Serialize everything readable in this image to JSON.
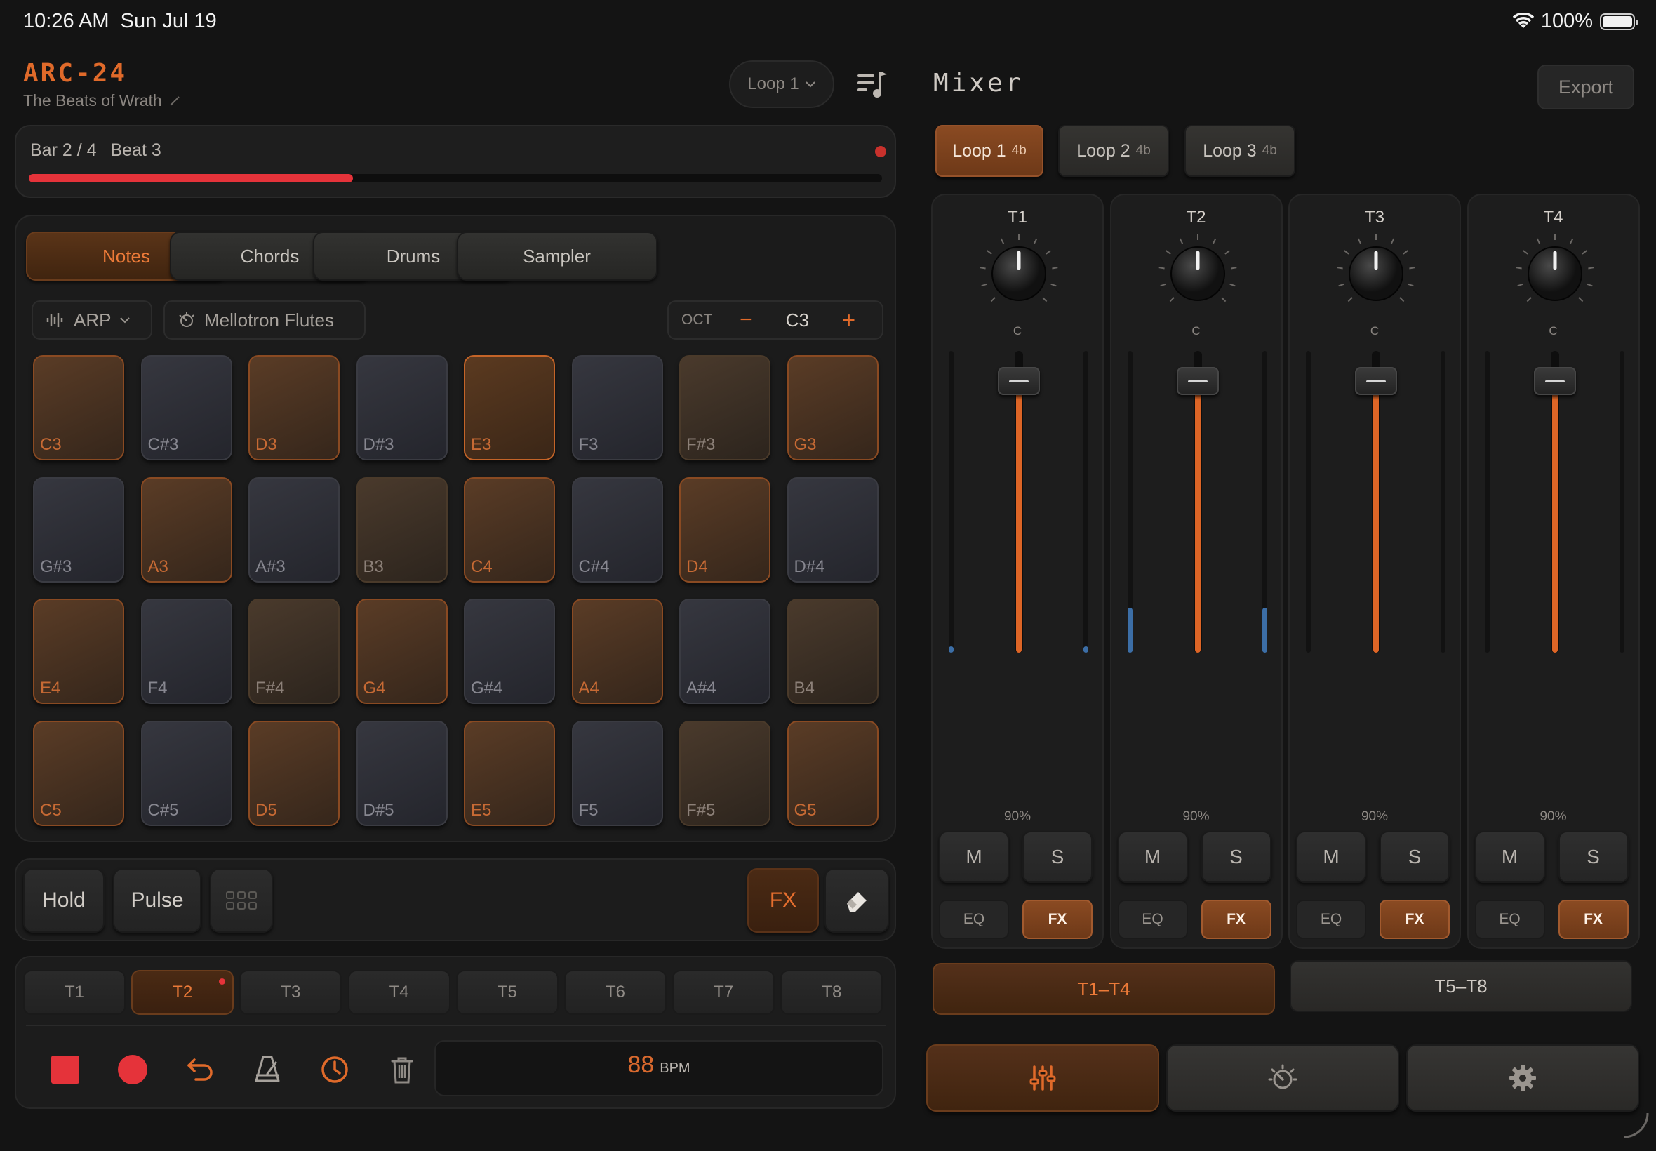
{
  "status": {
    "time": "10:26 AM",
    "date": "Sun Jul 19",
    "battery": "100%"
  },
  "header": {
    "app_title": "ARC-24",
    "song_title": "The Beats of Wrath",
    "loop_select": "Loop 1"
  },
  "progress": {
    "bar": "Bar 2 / 4",
    "beat": "Beat 3",
    "fraction": 0.38
  },
  "tabs": [
    {
      "label": "Notes",
      "active": true
    },
    {
      "label": "Chords",
      "active": false
    },
    {
      "label": "Drums",
      "active": false
    },
    {
      "label": "Sampler",
      "active": false
    }
  ],
  "options": {
    "mode": "ARP",
    "instrument": "Mellotron Flutes",
    "oct_label": "OCT",
    "oct_minus": "−",
    "oct_value": "C3",
    "oct_plus": "+"
  },
  "pads": [
    {
      "note": "C3",
      "type": "hl"
    },
    {
      "note": "C#3",
      "type": "sharp"
    },
    {
      "note": "D3",
      "type": "hl"
    },
    {
      "note": "D#3",
      "type": "sharp"
    },
    {
      "note": "E3",
      "type": "hot"
    },
    {
      "note": "F3",
      "type": "sharp"
    },
    {
      "note": "F#3",
      "type": "nat"
    },
    {
      "note": "G3",
      "type": "hl"
    },
    {
      "note": "G#3",
      "type": "sharp"
    },
    {
      "note": "A3",
      "type": "hl"
    },
    {
      "note": "A#3",
      "type": "sharp"
    },
    {
      "note": "B3",
      "type": "nat"
    },
    {
      "note": "C4",
      "type": "hl"
    },
    {
      "note": "C#4",
      "type": "sharp"
    },
    {
      "note": "D4",
      "type": "hl"
    },
    {
      "note": "D#4",
      "type": "sharp"
    },
    {
      "note": "E4",
      "type": "hl"
    },
    {
      "note": "F4",
      "type": "sharp"
    },
    {
      "note": "F#4",
      "type": "nat"
    },
    {
      "note": "G4",
      "type": "hl"
    },
    {
      "note": "G#4",
      "type": "sharp"
    },
    {
      "note": "A4",
      "type": "hl"
    },
    {
      "note": "A#4",
      "type": "sharp"
    },
    {
      "note": "B4",
      "type": "nat"
    },
    {
      "note": "C5",
      "type": "hl"
    },
    {
      "note": "C#5",
      "type": "sharp"
    },
    {
      "note": "D5",
      "type": "hl"
    },
    {
      "note": "D#5",
      "type": "sharp"
    },
    {
      "note": "E5",
      "type": "hl"
    },
    {
      "note": "F5",
      "type": "sharp"
    },
    {
      "note": "F#5",
      "type": "nat"
    },
    {
      "note": "G5",
      "type": "hl"
    }
  ],
  "hold_bar": {
    "hold": "Hold",
    "pulse": "Pulse",
    "fx": "FX",
    "grid_icon": "grid-icon",
    "eraser_icon": "eraser-icon"
  },
  "tracks": [
    {
      "label": "T1",
      "active": false
    },
    {
      "label": "T2",
      "active": true
    },
    {
      "label": "T3",
      "active": false
    },
    {
      "label": "T4",
      "active": false
    },
    {
      "label": "T5",
      "active": false
    },
    {
      "label": "T6",
      "active": false
    },
    {
      "label": "T7",
      "active": false
    },
    {
      "label": "T8",
      "active": false
    }
  ],
  "transport": {
    "bpm_value": "88",
    "bpm_unit": "BPM"
  },
  "mixer": {
    "title": "Mixer",
    "export": "Export",
    "loops": [
      {
        "label": "Loop 1",
        "beats": "4b",
        "active": true
      },
      {
        "label": "Loop 2",
        "beats": "4b",
        "active": false
      },
      {
        "label": "Loop 3",
        "beats": "4b",
        "active": false
      }
    ],
    "channels": [
      {
        "name": "T1",
        "pan": "C",
        "volume_label": "90%",
        "volume": 0.9,
        "meter_left": 0.02,
        "meter_right": 0.02,
        "mute": "M",
        "solo": "S",
        "eq": "EQ",
        "fx": "FX"
      },
      {
        "name": "T2",
        "pan": "C",
        "volume_label": "90%",
        "volume": 0.9,
        "meter_left": 0.15,
        "meter_right": 0.15,
        "mute": "M",
        "solo": "S",
        "eq": "EQ",
        "fx": "FX"
      },
      {
        "name": "T3",
        "pan": "C",
        "volume_label": "90%",
        "volume": 0.9,
        "meter_left": 0.0,
        "meter_right": 0.0,
        "mute": "M",
        "solo": "S",
        "eq": "EQ",
        "fx": "FX"
      },
      {
        "name": "T4",
        "pan": "C",
        "volume_label": "90%",
        "volume": 0.9,
        "meter_left": 0.0,
        "meter_right": 0.0,
        "mute": "M",
        "solo": "S",
        "eq": "EQ",
        "fx": "FX"
      }
    ],
    "banks": [
      {
        "label": "T1–T4",
        "active": true
      },
      {
        "label": "T5–T8",
        "active": false
      }
    ]
  },
  "colors": {
    "accent": "#e06a2a",
    "record": "#e5333a",
    "meter": "#3c6ea6"
  }
}
